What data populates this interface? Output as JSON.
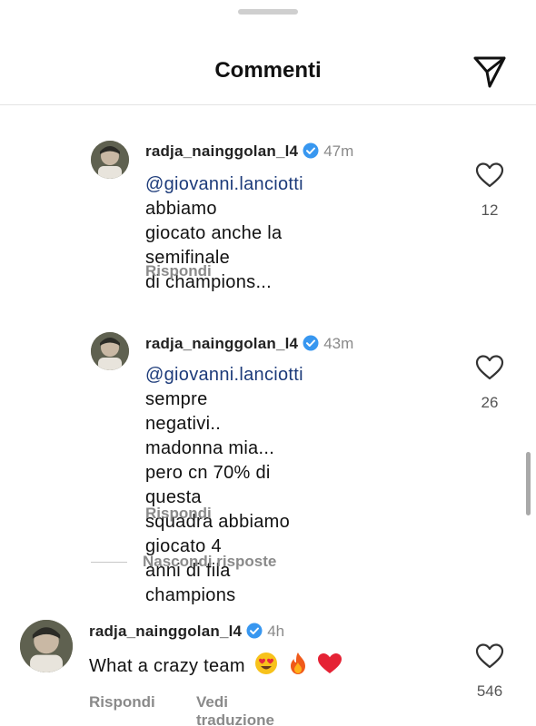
{
  "header": {
    "title": "Commenti",
    "send_icon": "paper-plane-icon"
  },
  "replies": [
    {
      "username": "radja_nainggolan_l4",
      "verified": true,
      "time": "47m",
      "mention": "@giovanni.lanciotti",
      "lines": [
        " abbiamo",
        "giocato anche la semifinale",
        "di champions..."
      ],
      "reply_label": "Rispondi",
      "likes": "12"
    },
    {
      "username": "radja_nainggolan_l4",
      "verified": true,
      "time": "43m",
      "mention": "@giovanni.lanciotti",
      "lines": [
        " sempre",
        "negativi.. madonna mia...",
        "pero cn 70% di questa",
        "squadra abbiamo giocato 4",
        "anni di fila champions"
      ],
      "reply_label": "Rispondi",
      "likes": "26"
    }
  ],
  "hide_replies_label": "Nascondi risposte",
  "top_comment": {
    "username": "radja_nainggolan_l4",
    "verified": true,
    "time": "4h",
    "text": "What a crazy team",
    "emojis": [
      "heart-eyes-emoji",
      "fire-emoji",
      "red-heart-emoji"
    ],
    "reply_label": "Rispondi",
    "translate_label": "Vedi traduzione",
    "likes": "546"
  },
  "colors": {
    "mention": "#1d3b7a",
    "verified": "#3897f0",
    "muted": "#8a8a8a"
  }
}
